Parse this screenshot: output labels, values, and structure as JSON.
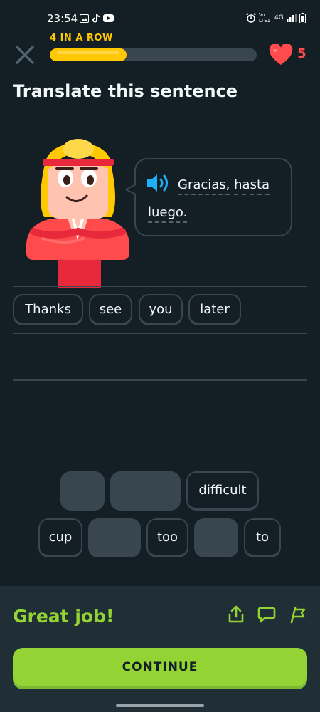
{
  "status_bar": {
    "time": "23:54",
    "network_label": "4G",
    "carrier_label": "Vo LTE1"
  },
  "header": {
    "streak_label": "4 IN A ROW",
    "progress": 0.37,
    "hearts": "5",
    "colors": {
      "streak": "#ffc800",
      "heart": "#ff4b4b"
    }
  },
  "challenge": {
    "title": "Translate this sentence",
    "prompt_words": [
      "Gracias,",
      "hasta",
      "luego."
    ]
  },
  "answer": {
    "words": [
      "Thanks",
      "see",
      "you",
      "later"
    ]
  },
  "word_bank": {
    "row1": [
      {
        "label": "",
        "used": true
      },
      {
        "label": "",
        "used": true
      },
      {
        "label": "difficult",
        "used": false
      }
    ],
    "row2": [
      {
        "label": "cup",
        "used": false
      },
      {
        "label": "",
        "used": true
      },
      {
        "label": "too",
        "used": false
      },
      {
        "label": "",
        "used": true
      },
      {
        "label": "to",
        "used": false
      }
    ]
  },
  "feedback": {
    "message": "Great job!",
    "continue_label": "CONTINUE",
    "icons": [
      "share-icon",
      "comment-icon",
      "report-flag-icon"
    ],
    "colors": {
      "success": "#93d333"
    }
  }
}
